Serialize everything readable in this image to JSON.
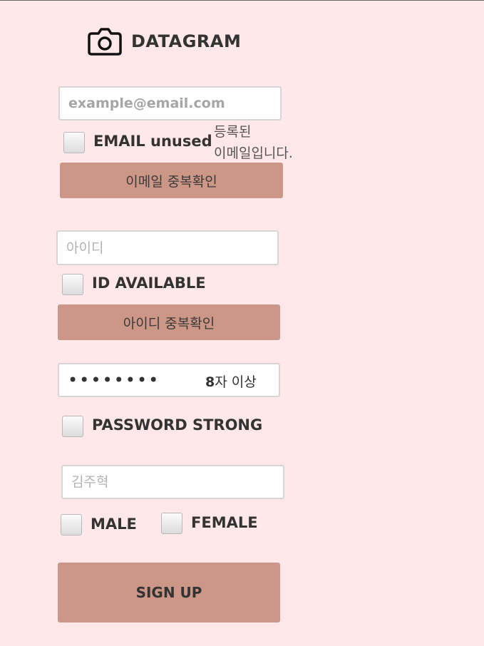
{
  "app": {
    "title": "DATAGRAM",
    "logo_icon": "camera-icon"
  },
  "email": {
    "placeholder": "example@email.com",
    "value": "",
    "check_label": "EMAIL unused",
    "message_line1": "등록된",
    "message_line2": "이메일입니다.",
    "check_button": "이메일 중복확인"
  },
  "id": {
    "placeholder": "아이디",
    "value": "",
    "check_label": "ID AVAILABLE",
    "check_button": "아이디 중복확인"
  },
  "password": {
    "value": "12345678",
    "hint_number": "8",
    "hint_text": "자 이상",
    "check_label": "PASSWORD STRONG"
  },
  "name": {
    "placeholder": "김주혁",
    "value": ""
  },
  "gender": {
    "male_label": "MALE",
    "female_label": "FEMALE"
  },
  "submit": {
    "label": "SIGN UP"
  },
  "colors": {
    "background": "#ffe7ea",
    "button": "#cc9787"
  }
}
